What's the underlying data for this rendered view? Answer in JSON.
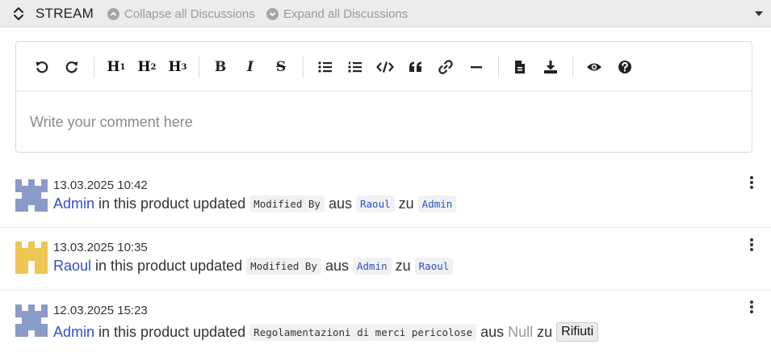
{
  "header": {
    "title": "STREAM",
    "collapse_label": "Collapse all Discussions",
    "expand_label": "Expand all Discussions"
  },
  "editor": {
    "placeholder": "Write your comment here",
    "toolbar": {
      "h1": "H",
      "h1_sub": "1",
      "h2": "H",
      "h2_sub": "2",
      "h3": "H",
      "h3_sub": "3",
      "bold": "B",
      "italic": "I",
      "strike": "S"
    }
  },
  "colors": {
    "accent_blue": "#2e4fc4",
    "avatar_admin": "#8a9bc8",
    "avatar_raoul": "#efc556"
  },
  "stream": [
    {
      "timestamp": "13.03.2025 10:42",
      "user": "Admin",
      "action": "in this product updated",
      "field": "Modified By",
      "from_word": "aus",
      "from_value": "Raoul",
      "to_word": "zu",
      "to_value": "Admin"
    },
    {
      "timestamp": "13.03.2025 10:35",
      "user": "Raoul",
      "action": "in this product updated",
      "field": "Modified By",
      "from_word": "aus",
      "from_value": "Admin",
      "to_word": "zu",
      "to_value": "Raoul"
    },
    {
      "timestamp": "12.03.2025 15:23",
      "user": "Admin",
      "action": "in this product updated",
      "field": "Regolamentazioni di merci pericolose",
      "from_word": "aus",
      "from_value": "Null",
      "to_word": "zu",
      "to_value": "Rifiuti"
    }
  ]
}
